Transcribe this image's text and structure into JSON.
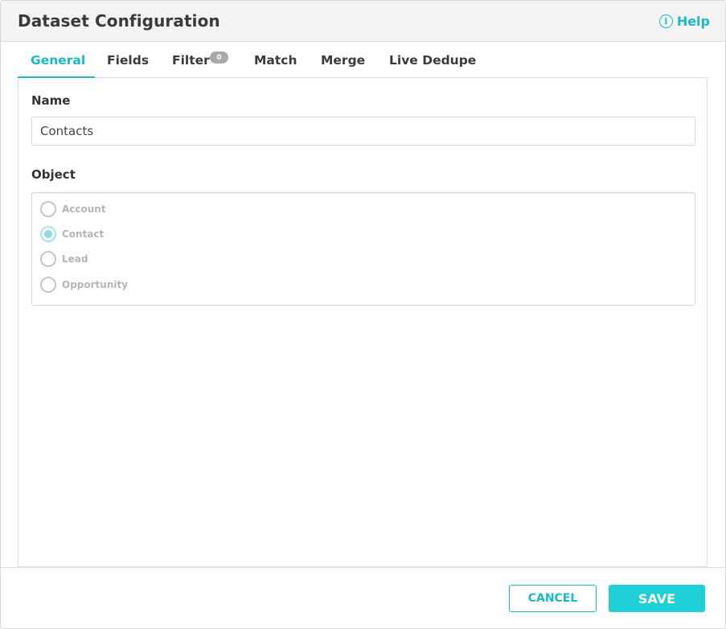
{
  "header": {
    "title": "Dataset Configuration",
    "help_label": "Help"
  },
  "tabs": [
    {
      "label": "General",
      "active": true
    },
    {
      "label": "Fields"
    },
    {
      "label": "Filter",
      "badge": "0"
    },
    {
      "label": "Match"
    },
    {
      "label": "Merge"
    },
    {
      "label": "Live Dedupe"
    }
  ],
  "general": {
    "name_label": "Name",
    "name_value": "Contacts",
    "object_label": "Object",
    "object_options": [
      {
        "label": "Account",
        "checked": false
      },
      {
        "label": "Contact",
        "checked": true
      },
      {
        "label": "Lead",
        "checked": false
      },
      {
        "label": "Opportunity",
        "checked": false
      }
    ]
  },
  "footer": {
    "cancel_label": "CANCEL",
    "save_label": "SAVE"
  },
  "colors": {
    "accent": "#1cb8c4",
    "save_button": "#1ecfd5",
    "badge": "#a9a9a9"
  }
}
